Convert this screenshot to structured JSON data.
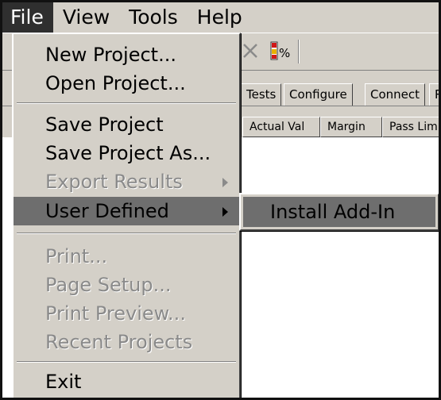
{
  "menubar": {
    "items": [
      "File",
      "View",
      "Tools",
      "Help"
    ]
  },
  "tabs": [
    "Tests",
    "Configure",
    "Connect",
    "R"
  ],
  "columns": [
    "Actual Val",
    "Margin",
    "Pass Lim"
  ],
  "file_menu": {
    "new_project": "New Project...",
    "open_project": "Open Project...",
    "save_project": "Save Project",
    "save_project_as": "Save Project As...",
    "export_results": "Export Results",
    "user_defined": "User Defined",
    "print": "Print...",
    "page_setup": "Page Setup...",
    "print_preview": "Print Preview...",
    "recent_projects": "Recent Projects",
    "exit": "Exit"
  },
  "submenu": {
    "install_addin": "Install Add-In"
  },
  "colors": {
    "chrome": "#d4d0c8",
    "menu_active_bg": "#2f2f2f",
    "highlight": "#6e6e6e",
    "disabled_text": "#8a8a8a"
  },
  "icons": {
    "toolbar_delete": "delete-x-icon",
    "toolbar_percent": "percent-icon",
    "submenu_arrow": "chevron-right-icon"
  }
}
